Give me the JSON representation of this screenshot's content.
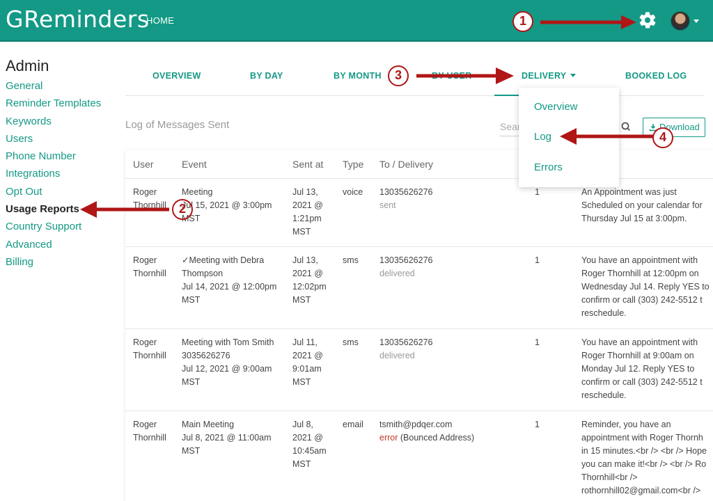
{
  "app": {
    "logo": "GReminders",
    "home_label": "HOME"
  },
  "sidebar": {
    "title": "Admin",
    "items": [
      {
        "label": "General"
      },
      {
        "label": "Reminder Templates"
      },
      {
        "label": "Keywords"
      },
      {
        "label": "Users"
      },
      {
        "label": "Phone Number"
      },
      {
        "label": "Integrations"
      },
      {
        "label": "Opt Out"
      },
      {
        "label": "Usage Reports",
        "active": true
      },
      {
        "label": "Country Support"
      },
      {
        "label": "Advanced"
      },
      {
        "label": "Billing"
      }
    ]
  },
  "tabs": [
    {
      "label": "OVERVIEW"
    },
    {
      "label": "BY DAY"
    },
    {
      "label": "BY MONTH"
    },
    {
      "label": "BY USER"
    },
    {
      "label": "DELIVERY",
      "active": true
    },
    {
      "label": "BOOKED LOG"
    }
  ],
  "log": {
    "title": "Log of Messages Sent",
    "search_placeholder": "Search",
    "download_label": "Download"
  },
  "dropdown": {
    "items": [
      {
        "label": "Overview"
      },
      {
        "label": "Log"
      },
      {
        "label": "Errors"
      }
    ]
  },
  "table": {
    "headers": [
      "User",
      "Event",
      "Sent at",
      "Type",
      "To / Delivery"
    ],
    "rows": [
      {
        "user": [
          "Roger",
          "Thornhill"
        ],
        "event": [
          "Meeting",
          "Jul 15, 2021 @ 3:00pm",
          "MST"
        ],
        "sent": [
          "Jul 13,",
          "2021 @",
          "1:21pm",
          "MST"
        ],
        "type": "voice",
        "to": "13035626276",
        "status": "sent",
        "count": "1",
        "message": [
          "An Appointment was just",
          "Scheduled on your calendar for",
          "Thursday Jul 15 at 3:00pm."
        ]
      },
      {
        "user": [
          "Roger",
          "Thornhill"
        ],
        "event": [
          "✓Meeting with Debra",
          "Thompson",
          "Jul 14, 2021 @ 12:00pm",
          "MST"
        ],
        "sent": [
          "Jul 13,",
          "2021 @",
          "12:02pm",
          "MST"
        ],
        "type": "sms",
        "to": "13035626276",
        "status": "delivered",
        "count": "1",
        "message": [
          "You have an appointment with",
          "Roger Thornhill at 12:00pm on",
          "Wednesday Jul 14. Reply YES to",
          "confirm or call (303) 242-5512 t",
          "reschedule."
        ]
      },
      {
        "user": [
          "Roger",
          "Thornhill"
        ],
        "event": [
          "Meeting with Tom Smith",
          "3035626276",
          "Jul 12, 2021 @ 9:00am",
          "MST"
        ],
        "sent": [
          "Jul 11,",
          "2021 @",
          "9:01am",
          "MST"
        ],
        "type": "sms",
        "to": "13035626276",
        "status": "delivered",
        "count": "1",
        "message": [
          "You have an appointment with",
          "Roger Thornhill at 9:00am on",
          "Monday Jul 12. Reply YES to",
          "confirm or call (303) 242-5512 t",
          "reschedule."
        ]
      },
      {
        "user": [
          "Roger",
          "Thornhill"
        ],
        "event": [
          "Main Meeting",
          "Jul 8, 2021 @ 11:00am",
          "MST"
        ],
        "sent": [
          "Jul 8,",
          "2021 @",
          "10:45am",
          "MST"
        ],
        "type": "email",
        "to": "tsmith@pdqer.com",
        "status": "error",
        "status_detail": " (Bounced Address)",
        "count": "1",
        "message": [
          "Reminder, you have an",
          "appointment with Roger Thornh",
          "in 15 minutes.<br /> <br /> Hope",
          "you can make it!<br /> <br /> Ro",
          "Thornhill<br />",
          "rothornhill02@gmail.com<br />"
        ]
      }
    ]
  },
  "annotations": [
    "1",
    "2",
    "3",
    "4"
  ],
  "icons": {
    "settings": "gear-icon",
    "search": "search-icon",
    "download": "download-icon",
    "avatar": "user-avatar"
  },
  "colors": {
    "brand": "#139985",
    "annotation": "#b01616",
    "error": "#c0392b"
  }
}
